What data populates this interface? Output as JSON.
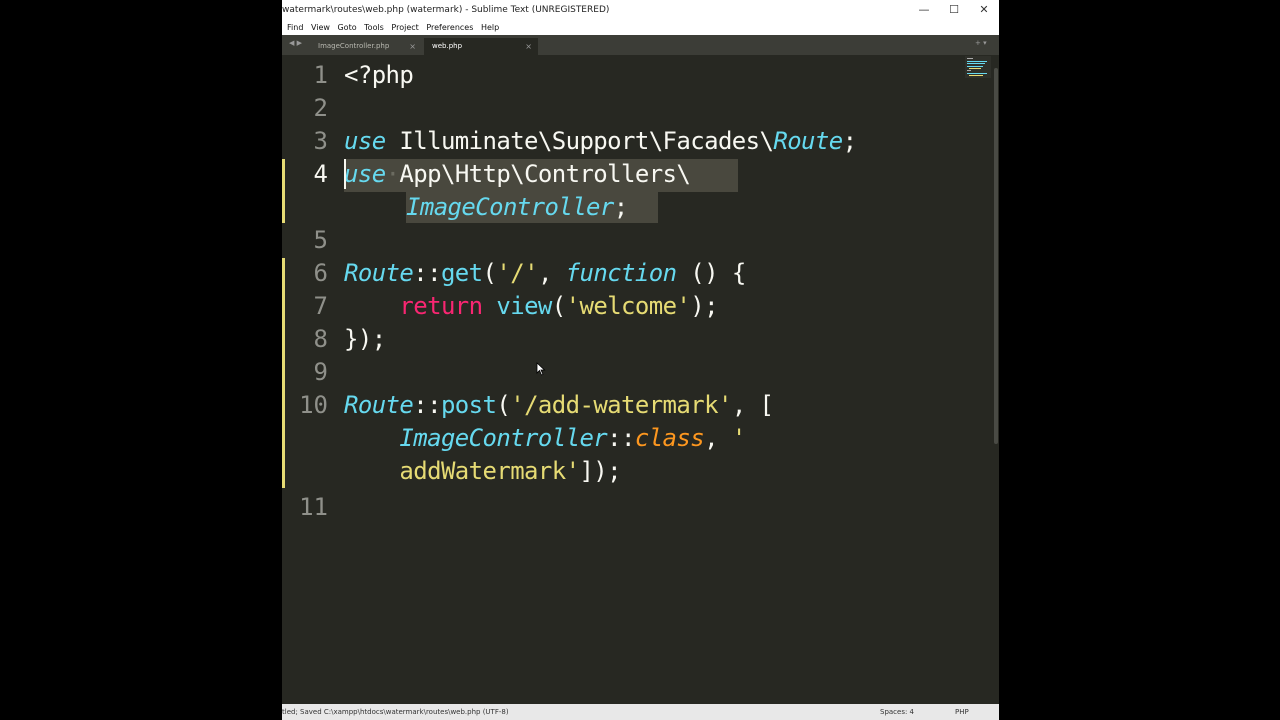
{
  "window": {
    "title": "watermark\\routes\\web.php (watermark) - Sublime Text (UNREGISTERED)",
    "minimize_glyph": "—",
    "maximize_glyph": "☐",
    "close_glyph": "✕"
  },
  "menu": [
    "Find",
    "View",
    "Goto",
    "Tools",
    "Project",
    "Preferences",
    "Help"
  ],
  "tabs": [
    {
      "label": "ImageController.php",
      "close": "×"
    },
    {
      "label": "web.php",
      "close": "×"
    }
  ],
  "nav_arrows": "◀ ▶",
  "tab_actions": "+ ▾",
  "gutter": [
    "1",
    "2",
    "3",
    "4",
    "",
    "5",
    "6",
    "7",
    "8",
    "9",
    "10",
    "",
    "",
    "11"
  ],
  "code": {
    "l1": "<?php",
    "l3_use": "use",
    "l3_ns": " Illuminate\\Support\\Facades\\",
    "l3_cls": "Route",
    "l3_end": ";",
    "l4_use": "use",
    "l4_dot": "·",
    "l4_ns": "App\\Http\\Controllers\\",
    "l4b_cls": "ImageController",
    "l4b_end": ";",
    "l6_route": "Route",
    "l6_sep": "::",
    "l6_get": "get",
    "l6_p1": "(",
    "l6_str": "'/'",
    "l6_comma": ", ",
    "l6_function": "function",
    "l6_rest": " () {",
    "l7_indent": "    ",
    "l7_return": "return",
    "l7_sp": " ",
    "l7_view": "view",
    "l7_p": "(",
    "l7_str": "'welcome'",
    "l7_end": ");",
    "l8": "});",
    "l10_route": "Route",
    "l10_sep": "::",
    "l10_post": "post",
    "l10_p": "(",
    "l10_str": "'/add-watermark'",
    "l10_rest": ", [",
    "l10b_indent": "    ",
    "l10b_cls": "ImageController",
    "l10b_sep": "::",
    "l10b_class": "class",
    "l10b_comma": ", ",
    "l10b_quote": "'",
    "l10c_indent": "    ",
    "l10c_str": "addWatermark'",
    "l10c_end": "]);"
  },
  "status": {
    "message": "tled; Saved C:\\xampp\\htdocs\\watermark\\routes\\web.php (UTF-8)",
    "spaces": "Spaces: 4",
    "syntax": "PHP"
  },
  "colors": {
    "background": "#272822",
    "keyword": "#66d9ef",
    "string": "#e6db74",
    "return": "#f92672",
    "class_const": "#fd971f"
  }
}
